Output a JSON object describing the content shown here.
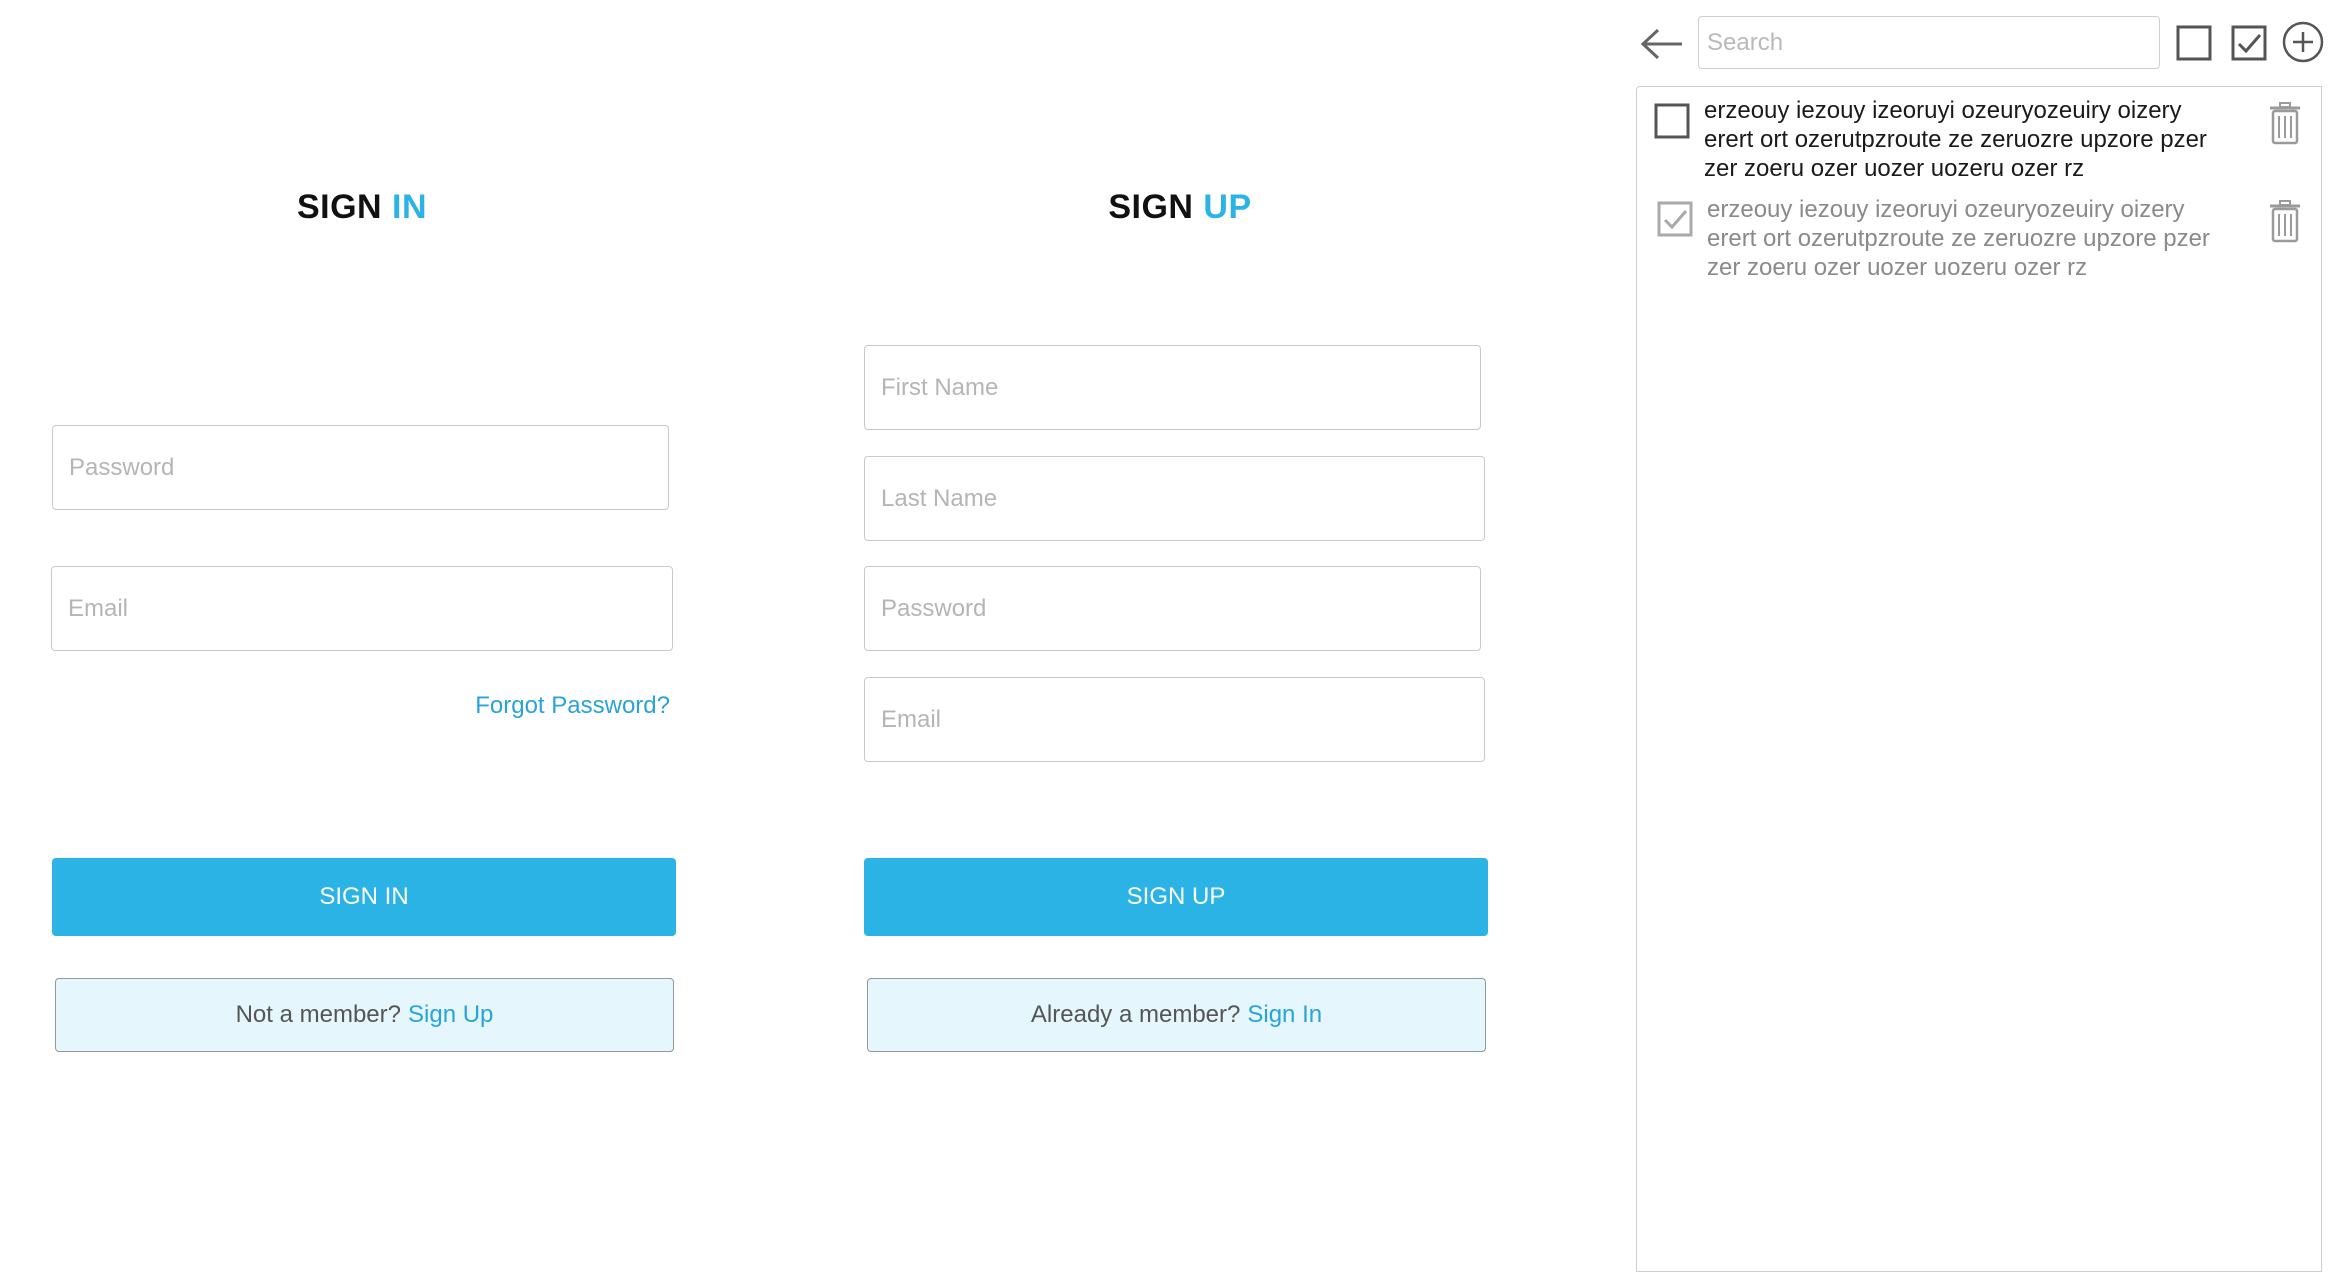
{
  "signin": {
    "title_part1": "SIGN",
    "title_part2": "IN",
    "password_placeholder": "Password",
    "email_placeholder": "Email",
    "forgot_password": "Forgot Password?",
    "submit_label": "SIGN IN",
    "switch_prompt": "Not a member?",
    "switch_link": "Sign Up"
  },
  "signup": {
    "title_part1": "SIGN",
    "title_part2": "UP",
    "first_name_placeholder": "First Name",
    "last_name_placeholder": "Last Name",
    "password_placeholder": "Password",
    "email_placeholder": "Email",
    "submit_label": "SIGN UP",
    "switch_prompt": "Already a member?",
    "switch_link": "Sign In"
  },
  "todo": {
    "search_placeholder": "Search",
    "toolbar_icons": [
      "back-arrow-icon",
      "empty-checkbox-icon",
      "checked-checkbox-icon",
      "plus-circle-icon"
    ],
    "items": [
      {
        "checked": false,
        "line1": "erzeouy iezouy izeoruyi ozeuryozeuiry oizery",
        "line2": "erert ort ozerutpzroute  ze zeruozre upzore pzer",
        "line3": "zer zoeru ozer uozer uozeru ozer rz"
      },
      {
        "checked": true,
        "line1": "erzeouy iezouy izeoruyi ozeuryozeuiry oizery",
        "line2": "erert ort ozerutpzroute  ze zeruozre upzore pzer",
        "line3": "zer zoeru ozer uozer uozeru ozer rz"
      }
    ]
  },
  "colors": {
    "accent": "#2bb3e6",
    "link": "#2aa3d8",
    "secondary_bg": "#e5f7fc"
  }
}
